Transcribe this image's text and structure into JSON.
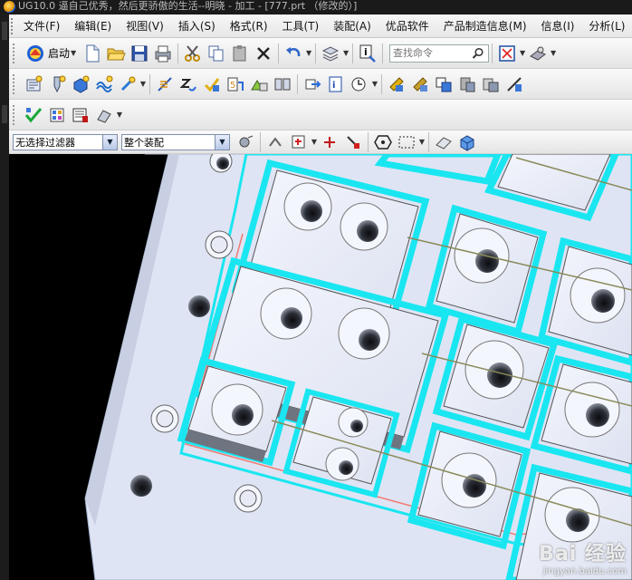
{
  "window": {
    "title": "UG10.0 逼自己优秀，然后更骄傲的生活--明晓 - 加工 - [777.prt （修改的）]"
  },
  "menu": {
    "items": [
      "文件(F)",
      "编辑(E)",
      "视图(V)",
      "插入(S)",
      "格式(R)",
      "工具(T)",
      "装配(A)",
      "优品软件",
      "产品制造信息(M)",
      "信息(I)",
      "分析(L)"
    ]
  },
  "toolbar": {
    "start_label": "启动",
    "search_placeholder": "查找命令"
  },
  "selection_bar": {
    "filter_value": "无选择过滤器",
    "scope_value": "整个装配"
  },
  "colors": {
    "plate": "#dfe4f4",
    "cyan_edge": "#19e6f0",
    "boss_face": "#eef1fb",
    "shadow": "#6f7580"
  },
  "watermark": {
    "brand": "Bai 经验",
    "url": "jingyan.baidu.com"
  },
  "icons": [
    "search-icon",
    "new-file-icon",
    "open-folder-icon",
    "save-icon",
    "print-icon",
    "cut-icon",
    "copy-icon",
    "paste-icon",
    "delete-icon",
    "undo-icon",
    "layer-icon",
    "info-icon",
    "fit-view-icon",
    "shade-icon"
  ]
}
